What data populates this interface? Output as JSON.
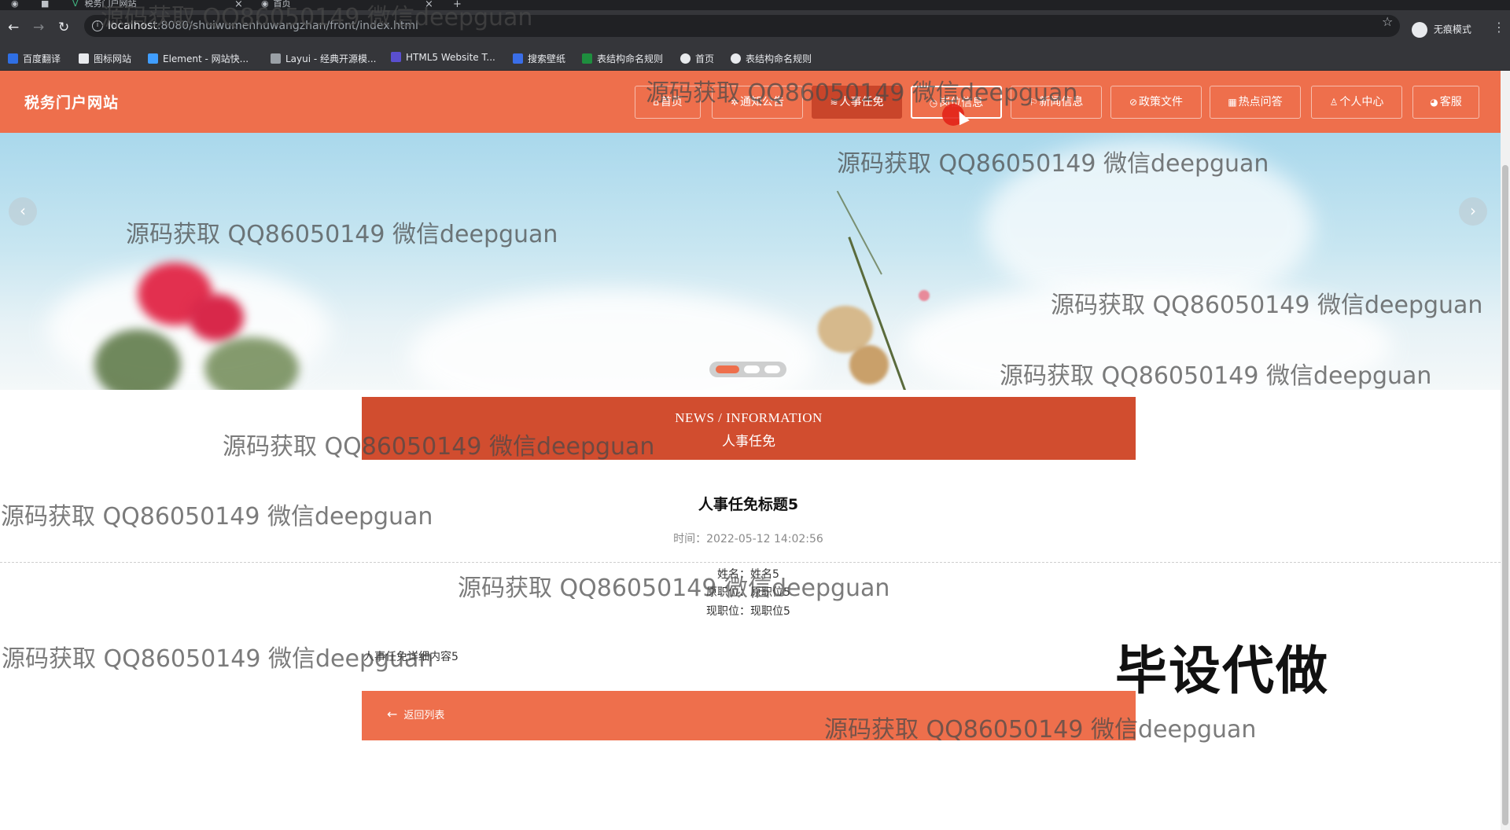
{
  "browser": {
    "tabs": [
      {
        "title": "税务门户网站"
      },
      {
        "title": "首页"
      }
    ],
    "new_tab_glyph": "+",
    "close_glyph": "×",
    "url_host": "localhost",
    "url_rest": ":8080/shuiwumenhuwangzhan/front/index.html",
    "incognito_label": "无痕模式",
    "bookmarks": [
      {
        "label": "百度翻译",
        "icon": "translate-icon",
        "color": "#2f6fe4"
      },
      {
        "label": "图标网站",
        "icon": "flag-icon",
        "color": "#e8eaed"
      },
      {
        "label": "Element - 网站快...",
        "icon": "element-icon",
        "color": "#409eff"
      },
      {
        "label": "Layui - 经典开源模...",
        "icon": "layui-icon",
        "color": "#9aa0a6"
      },
      {
        "label": "HTML5 Website T...",
        "icon": "html5-icon",
        "color": "#5a4fcf"
      },
      {
        "label": "搜索壁纸",
        "icon": "wallpaper-icon",
        "color": "#3a6ee8"
      },
      {
        "label": "表结构命名规则",
        "icon": "sheet-icon",
        "color": "#1e8e3e"
      },
      {
        "label": "首页",
        "icon": "globe-icon",
        "color": "#e8eaed"
      },
      {
        "label": "表结构命名规则",
        "icon": "globe-icon",
        "color": "#e8eaed"
      }
    ]
  },
  "site": {
    "title": "税务门户网站",
    "nav": [
      {
        "label": "首页",
        "icon": "home-icon",
        "glyph": "⌂"
      },
      {
        "label": "通知公告",
        "icon": "notice-icon",
        "glyph": "✲"
      },
      {
        "label": "人事任免",
        "icon": "layers-icon",
        "glyph": "≋",
        "active": true
      },
      {
        "label": "岗位信息",
        "icon": "info-icon",
        "glyph": "◷",
        "hover": true
      },
      {
        "label": "新闻信息",
        "icon": "flag-icon",
        "glyph": "⚐"
      },
      {
        "label": "政策文件",
        "icon": "link-icon",
        "glyph": "⊘"
      },
      {
        "label": "热点问答",
        "icon": "grid-icon",
        "glyph": "▦"
      },
      {
        "label": "个人中心",
        "icon": "user-icon",
        "glyph": "♙"
      },
      {
        "label": "客服",
        "icon": "service-icon",
        "glyph": "◕"
      }
    ]
  },
  "banner": {
    "prev_glyph": "‹",
    "next_glyph": "›",
    "slide_count": 3,
    "active_slide": 1
  },
  "section": {
    "en_title": "NEWS / INFORMATION",
    "cn_title": "人事任免"
  },
  "detail": {
    "title": "人事任免标题5",
    "time_label": "时间：",
    "time_value": "2022-05-12 14:02:56",
    "fields": [
      {
        "label": "姓名：",
        "value": "姓名5"
      },
      {
        "label": "原职位：",
        "value": "原职位5"
      },
      {
        "label": "现职位：",
        "value": "现职位5"
      }
    ],
    "content": "人事任免详细内容5",
    "back_label": "返回列表",
    "back_glyph": "←"
  },
  "overlays": {
    "watermark": "源码获取 QQ86050149 微信deepguan",
    "ad_text": "毕设代做"
  }
}
